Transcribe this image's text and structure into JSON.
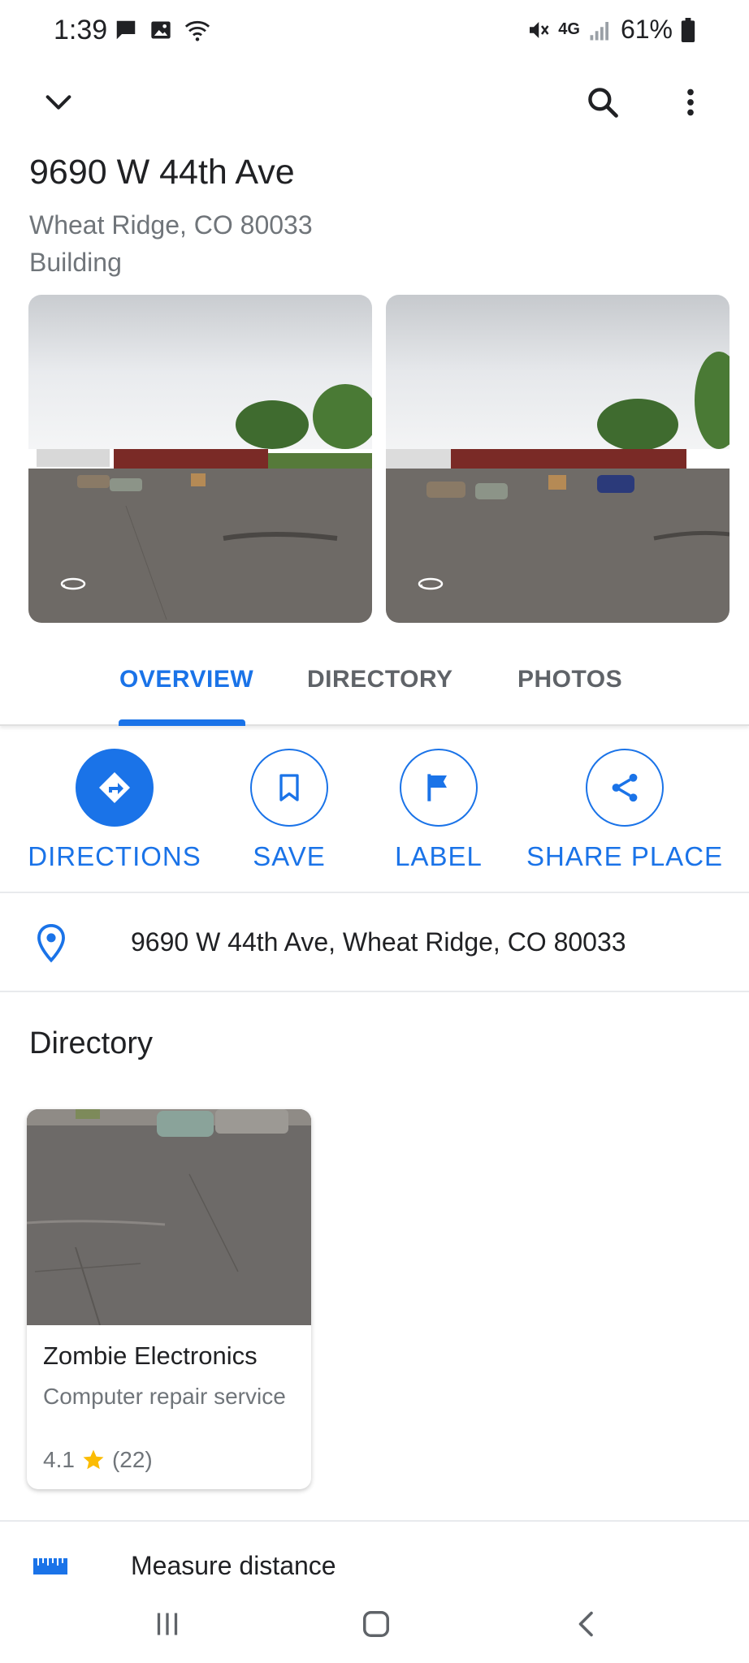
{
  "status_bar": {
    "time": "1:39",
    "battery": "61%",
    "network": "4G"
  },
  "header": {
    "title": "9690 W 44th Ave",
    "subtitle": "Wheat Ridge, CO 80033",
    "type": "Building"
  },
  "tabs": [
    {
      "label": "OVERVIEW",
      "active": true
    },
    {
      "label": "DIRECTORY",
      "active": false
    },
    {
      "label": "PHOTOS",
      "active": false
    }
  ],
  "actions": {
    "directions": "DIRECTIONS",
    "save": "SAVE",
    "label": "LABEL",
    "share": "SHARE PLACE"
  },
  "address": "9690 W 44th Ave, Wheat Ridge, CO 80033",
  "directory": {
    "heading": "Directory",
    "items": [
      {
        "name": "Zombie Electronics",
        "category": "Computer repair service",
        "rating": "4.1",
        "reviews": "(22)"
      }
    ]
  },
  "measure_distance": "Measure distance",
  "colors": {
    "accent": "#1a73e8",
    "star": "#fbbc04",
    "secondary_text": "#70757a"
  }
}
